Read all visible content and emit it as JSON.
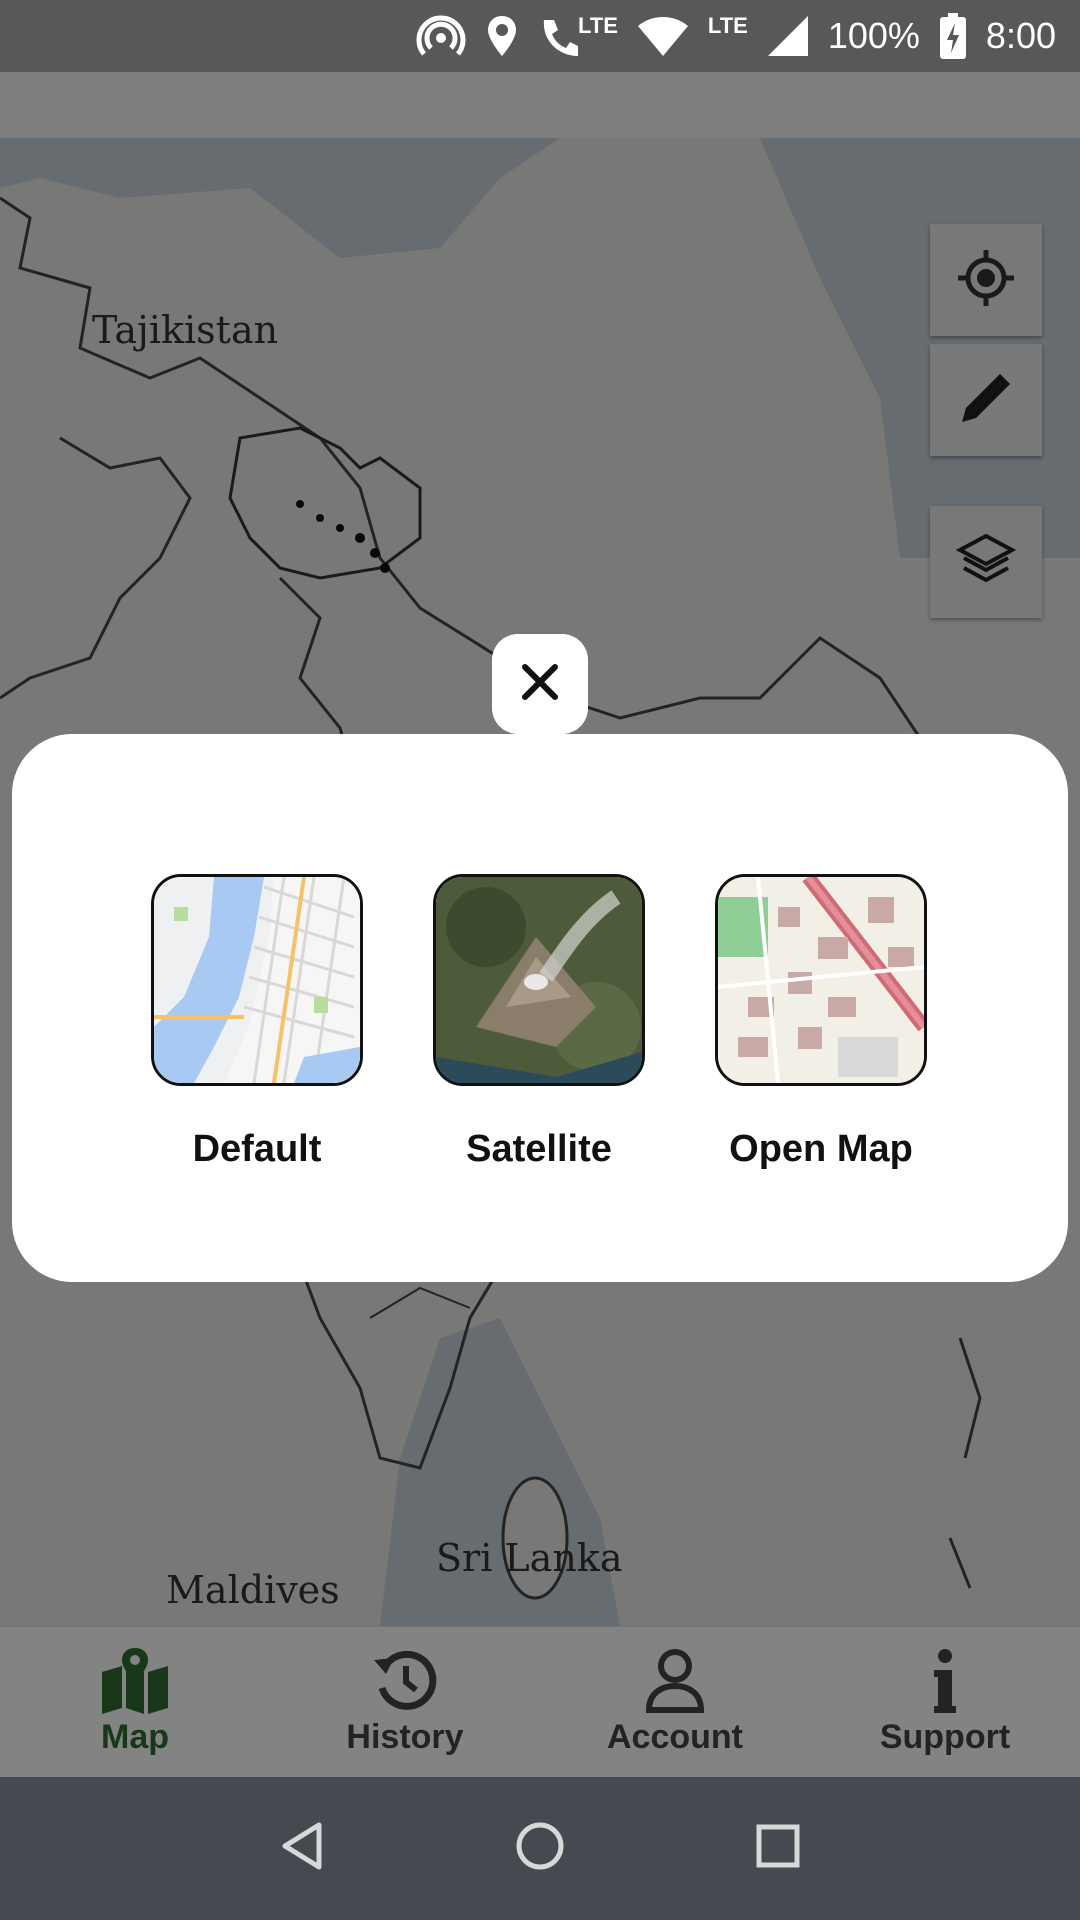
{
  "status_bar": {
    "battery": "100%",
    "time": "8:00",
    "lte_label": "LTE",
    "lte_call_label": "LTE",
    "icons": [
      "hotspot-icon",
      "location-icon",
      "lte-call-icon",
      "wifi-icon",
      "cell-signal-icon",
      "battery-charging-icon"
    ]
  },
  "map": {
    "labels": [
      "Tajikistan",
      "Sri Lanka",
      "Maldives"
    ]
  },
  "map_controls": {
    "icons": [
      "my-location-icon",
      "draw-icon",
      "layers-icon"
    ]
  },
  "layer_sheet": {
    "close_icon": "close-icon",
    "options": [
      {
        "label": "Default"
      },
      {
        "label": "Satellite"
      },
      {
        "label": "Open Map"
      }
    ]
  },
  "bottom_nav": {
    "items": [
      {
        "label": "Map",
        "icon": "map-icon",
        "active": true
      },
      {
        "label": "History",
        "icon": "history-icon",
        "active": false
      },
      {
        "label": "Account",
        "icon": "account-icon",
        "active": false
      },
      {
        "label": "Support",
        "icon": "info-icon",
        "active": false
      }
    ],
    "active_color": "#2e6b31"
  },
  "system_nav": {
    "icons": [
      "back-icon",
      "home-icon",
      "recents-icon"
    ]
  }
}
